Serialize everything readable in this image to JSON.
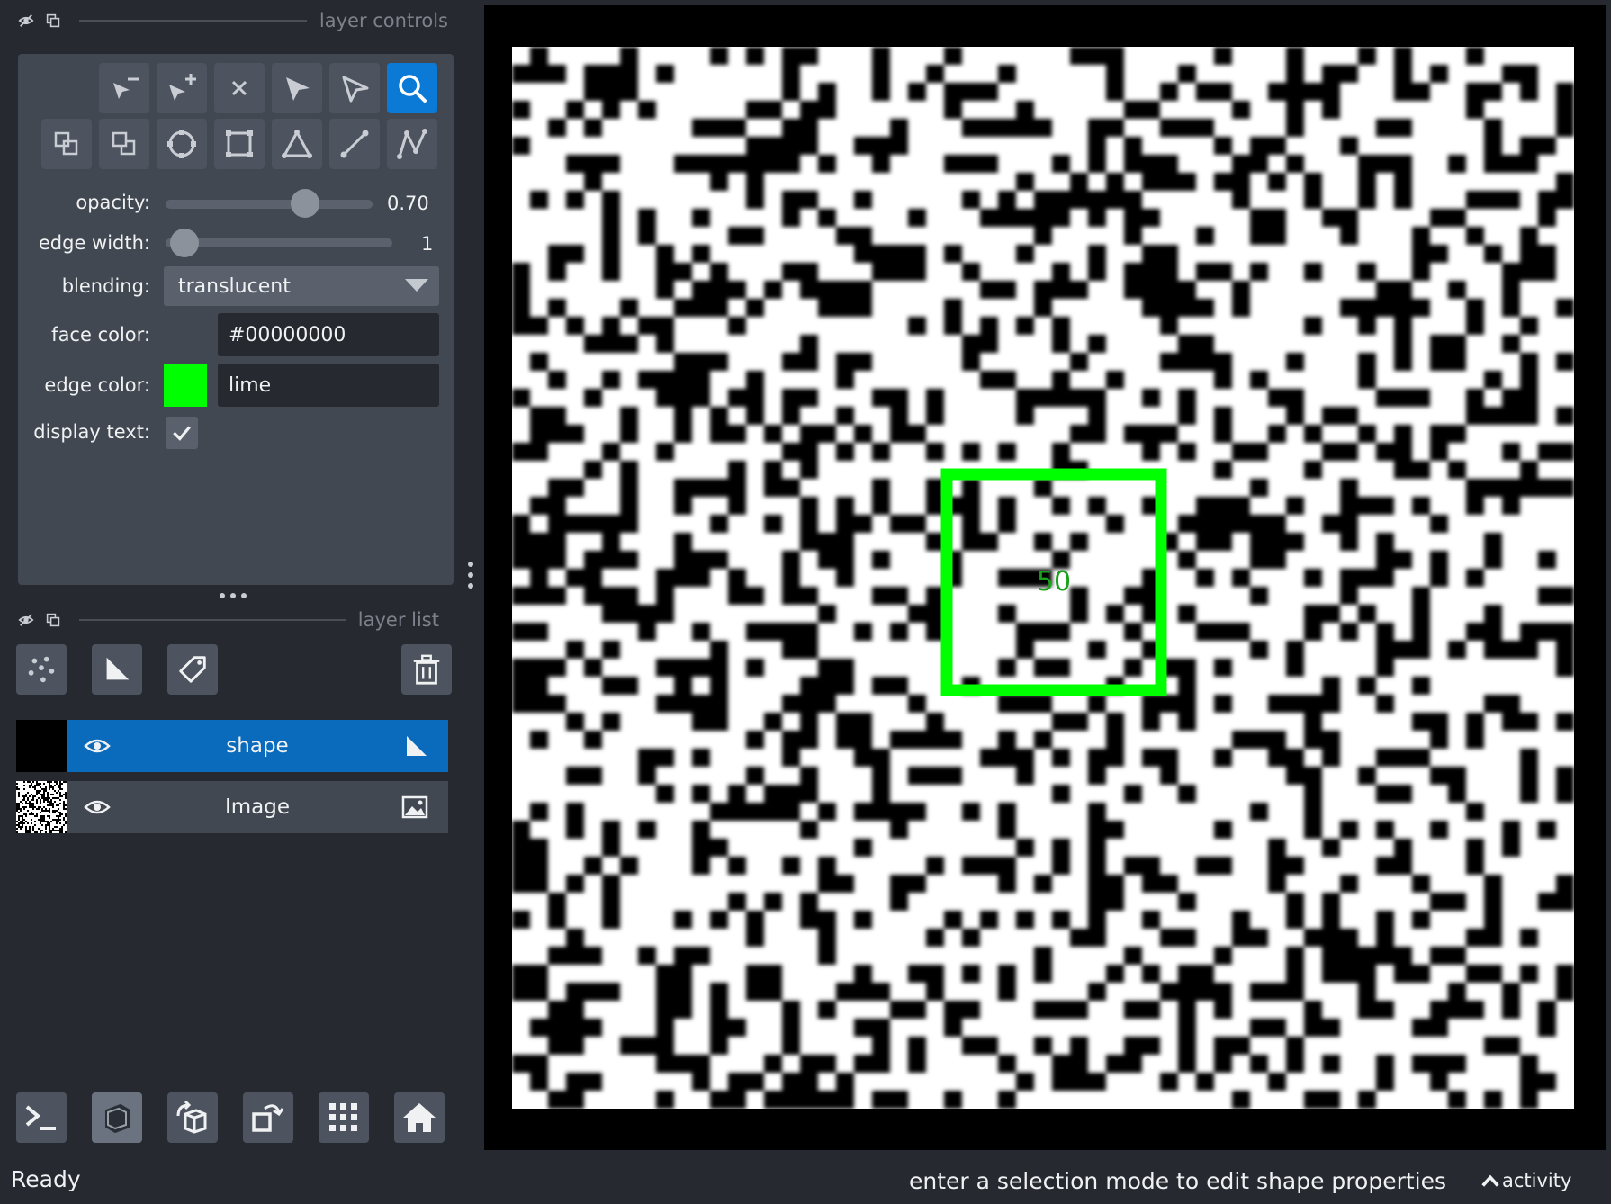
{
  "layer_controls": {
    "title": "layer controls",
    "opacity_label": "opacity:",
    "opacity_value": "0.70",
    "opacity_fraction": 0.7,
    "edge_width_label": "edge width:",
    "edge_width_value": "1",
    "blending_label": "blending:",
    "blending_value": "translucent",
    "face_color_label": "face color:",
    "face_color_value": "#00000000",
    "edge_color_label": "edge color:",
    "edge_color_value": "lime",
    "edge_color_swatch": "#00ff00",
    "display_text_label": "display text:",
    "display_text_checked": true
  },
  "layer_list": {
    "title": "layer list",
    "layers": [
      {
        "name": "shape",
        "selected": true,
        "type_icon": "shapes-icon"
      },
      {
        "name": "Image",
        "selected": false,
        "type_icon": "image-icon"
      }
    ]
  },
  "canvas": {
    "shape_text": "50",
    "shape_color": "#00ff00"
  },
  "status": {
    "ready": "Ready",
    "message": "enter a selection mode to edit shape properties",
    "activity": "activity"
  },
  "colors": {
    "accent": "#0a7ad6",
    "selected_layer": "#0a6bbc",
    "background": "#262930",
    "panel": "#414851"
  }
}
